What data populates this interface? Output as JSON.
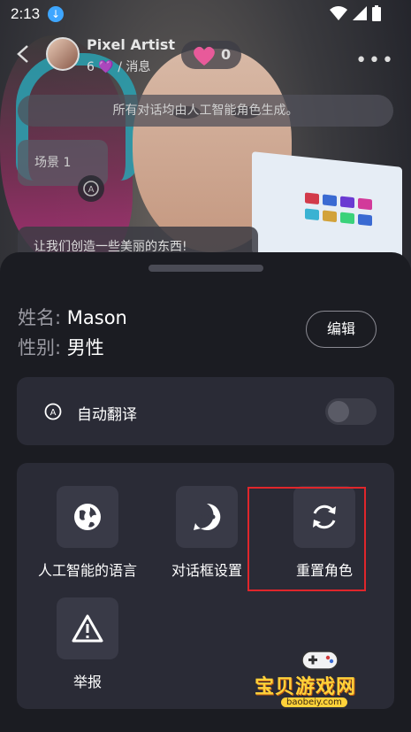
{
  "status_bar": {
    "time": "2:13"
  },
  "header": {
    "name": "Pixel Artist",
    "sub_count": "6",
    "sub_label": "/ 消息",
    "heart_count": "0"
  },
  "notice": "所有对话均由人工智能角色生成。",
  "scene_label": "场景 1",
  "chat_preview": "让我们创造一些美丽的东西!",
  "sheet": {
    "name_label": "姓名:",
    "name_value": "Mason",
    "gender_label": "性别:",
    "gender_value": "男性",
    "edit_label": "编辑",
    "auto_translate_label": "自动翻译",
    "auto_translate_on": false,
    "options": [
      {
        "label": "人工智能的语言",
        "icon": "globe-icon"
      },
      {
        "label": "对话框设置",
        "icon": "chat-dots-icon"
      },
      {
        "label": "重置角色",
        "icon": "refresh-icon"
      },
      {
        "label": "举报",
        "icon": "warning-icon"
      }
    ]
  },
  "watermark": {
    "title": "宝贝游戏网",
    "url": "baobeiy.com"
  },
  "colors": {
    "highlight": "#e0262b",
    "sheet_bg": "#1b1c22",
    "card_bg": "#2a2b36",
    "icon_box": "#393a47"
  }
}
